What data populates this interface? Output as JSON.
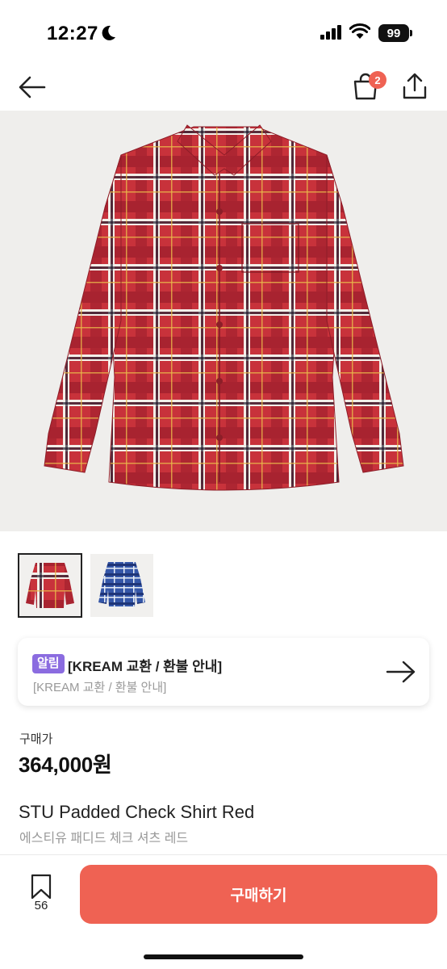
{
  "status_bar": {
    "time": "12:27",
    "battery": "99",
    "icons": [
      "moon-icon",
      "signal-icon",
      "wifi-icon",
      "battery-icon"
    ]
  },
  "nav": {
    "back_icon": "arrow-left-icon",
    "cart_icon": "shopping-bag-icon",
    "cart_badge": "2",
    "share_icon": "share-icon"
  },
  "colors": {
    "accent": "#ef6253",
    "tag_purple": "#8b6ce0",
    "hero_bg": "#efeeec",
    "shirt_red": "#c7323a",
    "thumb_blue": "#3456a8"
  },
  "gallery": {
    "thumbnails": [
      {
        "color": "red",
        "selected": true
      },
      {
        "color": "blue",
        "selected": false
      }
    ]
  },
  "notice": {
    "tag": "알림",
    "title": "[KREAM 교환 / 환불 안내]",
    "subtitle": "[KREAM 교환 / 환불 안내]",
    "arrow_icon": "arrow-right-icon"
  },
  "price": {
    "label": "구매가",
    "value": "364,000원"
  },
  "product": {
    "name": "STU Padded Check Shirt Red",
    "name_ko": "에스티유 패디드 체크 셔츠 레드"
  },
  "bottom_bar": {
    "bookmark_icon": "bookmark-icon",
    "bookmark_count": "56",
    "buy_label": "구매하기"
  }
}
